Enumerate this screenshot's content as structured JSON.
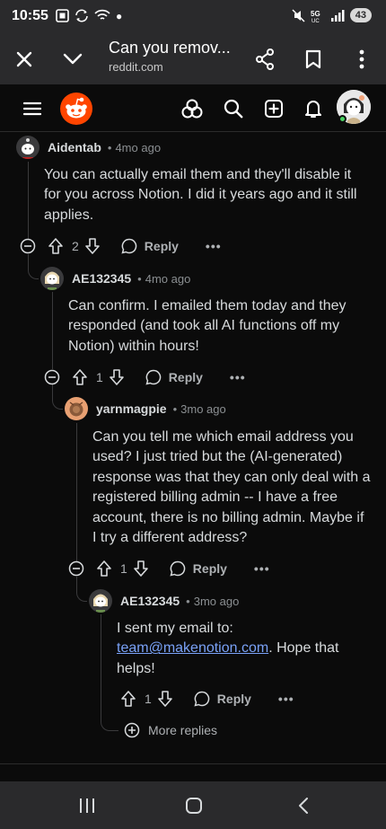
{
  "status_bar": {
    "time": "10:55",
    "battery": "43"
  },
  "browser": {
    "title": "Can you remov...",
    "url": "reddit.com"
  },
  "comments": [
    {
      "author": "Aidentab",
      "age": "4mo ago",
      "text": "You can actually email them and they'll disable it for you across Notion. I did it years ago and it still applies.",
      "votes": "2",
      "reply_label": "Reply",
      "more_label": "•••"
    },
    {
      "author": "AE132345",
      "age": "4mo ago",
      "text": "Can confirm. I emailed them today and they responded (and took all AI functions off my Notion) within hours!",
      "votes": "1",
      "reply_label": "Reply",
      "more_label": "•••"
    },
    {
      "author": "yarnmagpie",
      "age": "3mo ago",
      "text": "Can you tell me which email address you used? I just tried but the (AI-generated) response was that they can only deal with a registered billing admin -- I have a free account, there is no billing admin. Maybe if I try a different address?",
      "votes": "1",
      "reply_label": "Reply",
      "more_label": "•••"
    },
    {
      "author": "AE132345",
      "age": "3mo ago",
      "text_prefix": "I sent my email to: ",
      "link": "team@makenotion.com",
      "text_suffix": ". Hope that helps!",
      "votes": "1",
      "reply_label": "Reply",
      "more_label": "•••"
    }
  ],
  "more_replies_label": "More replies",
  "separator": "•",
  "colors": {
    "reddit_orange": "#ff4500",
    "link": "#7aa2f7",
    "online": "#46d160"
  }
}
